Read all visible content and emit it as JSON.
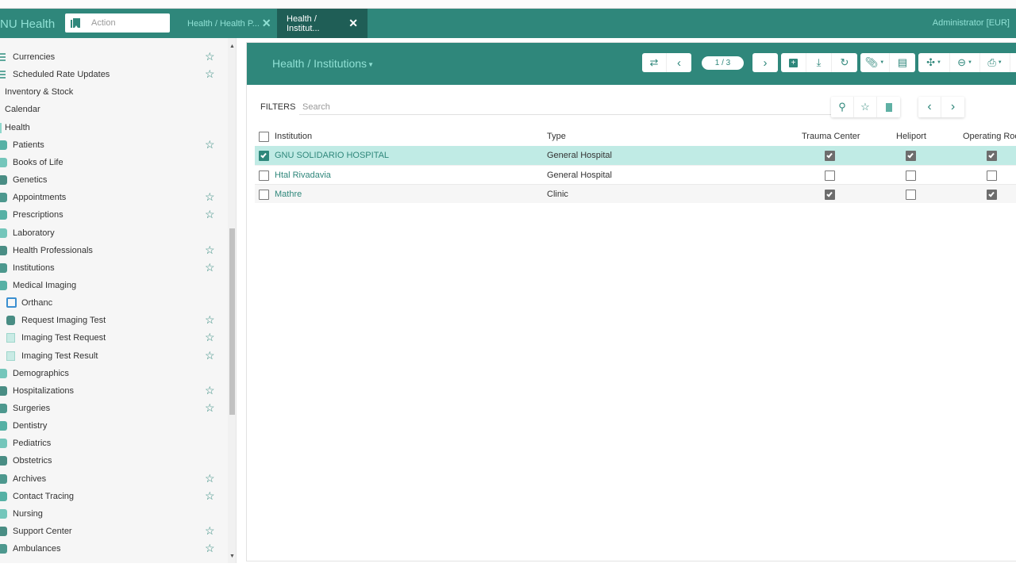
{
  "navbar": {
    "brand": "NU Health",
    "action_placeholder": "Action",
    "tabs": [
      {
        "label": "Health / Health P...",
        "active": false
      },
      {
        "label": "Health / Institut...",
        "active": true
      }
    ],
    "user": "Administrator [EUR]"
  },
  "sidebar": {
    "items": [
      {
        "label": "Currencies",
        "icon": "list-icon",
        "favorite": true,
        "level": 2
      },
      {
        "label": "Scheduled Rate Updates",
        "icon": "list-icon",
        "favorite": true,
        "level": 2
      },
      {
        "label": "Inventory & Stock",
        "icon": null,
        "favorite": false,
        "level": 0
      },
      {
        "label": "Calendar",
        "icon": null,
        "favorite": false,
        "level": 0
      },
      {
        "label": "Health",
        "icon": null,
        "favorite": false,
        "level": 0
      },
      {
        "label": "Patients",
        "icon": "patient-icon",
        "favorite": true,
        "level": 1
      },
      {
        "label": "Books of Life",
        "icon": "book-icon",
        "favorite": false,
        "level": 1
      },
      {
        "label": "Genetics",
        "icon": "dna-icon",
        "favorite": false,
        "level": 1
      },
      {
        "label": "Appointments",
        "icon": "clock-icon",
        "favorite": true,
        "level": 1
      },
      {
        "label": "Prescriptions",
        "icon": "rx-icon",
        "favorite": true,
        "level": 1
      },
      {
        "label": "Laboratory",
        "icon": "flask-icon",
        "favorite": false,
        "level": 1
      },
      {
        "label": "Health Professionals",
        "icon": "doctor-icon",
        "favorite": true,
        "level": 1
      },
      {
        "label": "Institutions",
        "icon": "building-icon",
        "favorite": true,
        "level": 1
      },
      {
        "label": "Medical Imaging",
        "icon": "xray-icon",
        "favorite": false,
        "level": 1
      },
      {
        "label": "Orthanc",
        "icon": "orthanc-icon",
        "favorite": false,
        "level": 2
      },
      {
        "label": "Request Imaging Test",
        "icon": "gears-icon",
        "favorite": true,
        "level": 2
      },
      {
        "label": "Imaging Test Request",
        "icon": "document-icon",
        "favorite": true,
        "level": 2
      },
      {
        "label": "Imaging Test Result",
        "icon": "document-icon",
        "favorite": true,
        "level": 2
      },
      {
        "label": "Demographics",
        "icon": "globe-icon",
        "favorite": false,
        "level": 1
      },
      {
        "label": "Hospitalizations",
        "icon": "bed-icon",
        "favorite": true,
        "level": 1
      },
      {
        "label": "Surgeries",
        "icon": "scalpel-icon",
        "favorite": true,
        "level": 1
      },
      {
        "label": "Dentistry",
        "icon": "tooth-icon",
        "favorite": false,
        "level": 1
      },
      {
        "label": "Pediatrics",
        "icon": "pacifier-icon",
        "favorite": false,
        "level": 1
      },
      {
        "label": "Obstetrics",
        "icon": "baby-icon",
        "favorite": false,
        "level": 1
      },
      {
        "label": "Archives",
        "icon": "archive-icon",
        "favorite": true,
        "level": 1
      },
      {
        "label": "Contact Tracing",
        "icon": "network-icon",
        "favorite": true,
        "level": 1
      },
      {
        "label": "Nursing",
        "icon": "nurse-icon",
        "favorite": false,
        "level": 1
      },
      {
        "label": "Support Center",
        "icon": "support-icon",
        "favorite": true,
        "level": 1
      },
      {
        "label": "Ambulances",
        "icon": "ambulance-icon",
        "favorite": true,
        "level": 1
      }
    ]
  },
  "main": {
    "title": "Health / Institutions",
    "pager": "1 / 3",
    "filters_label": "FILTERS",
    "search_placeholder": "Search",
    "columns": [
      "Institution",
      "Type",
      "Trauma Center",
      "Heliport",
      "Operating Roo"
    ],
    "rows": [
      {
        "institution": "GNU SOLIDARIO HOSPITAL",
        "type": "General Hospital",
        "trauma_center": true,
        "heliport": true,
        "operating_room": true,
        "selected": true
      },
      {
        "institution": "Htal Rivadavia",
        "type": "General Hospital",
        "trauma_center": false,
        "heliport": false,
        "operating_room": false,
        "selected": false
      },
      {
        "institution": "Mathre",
        "type": "Clinic",
        "trauma_center": true,
        "heliport": false,
        "operating_room": true,
        "selected": false
      }
    ]
  },
  "colors": {
    "brand": "#2f877b",
    "brand_light_text": "#8fe0d4",
    "active_tab": "#1f5e56",
    "selected_row": "#c0ebe5"
  }
}
